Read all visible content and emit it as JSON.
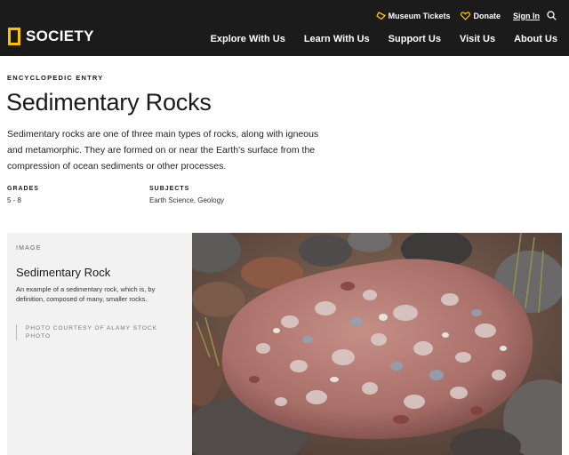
{
  "header": {
    "logo_text": "SOCIETY",
    "brand_color": "#fcc200",
    "utility": {
      "tickets_label": "Museum Tickets",
      "donate_label": "Donate",
      "signin_label": "Sign In"
    },
    "nav": [
      {
        "label": "Explore With Us"
      },
      {
        "label": "Learn With Us"
      },
      {
        "label": "Support Us"
      },
      {
        "label": "Visit Us"
      },
      {
        "label": "About Us"
      }
    ]
  },
  "article": {
    "eyebrow": "ENCYCLOPEDIC ENTRY",
    "title": "Sedimentary Rocks",
    "summary": "Sedimentary rocks are one of three main types of rocks, along with igneous and metamorphic. They are formed on or near the Earth's surface from the compression of ocean sediments or other processes.",
    "grades_label": "GRADES",
    "grades_value": "5 - 8",
    "subjects_label": "SUBJECTS",
    "subjects_value": "Earth Science, Geology"
  },
  "image_block": {
    "eyebrow": "IMAGE",
    "title": "Sedimentary Rock",
    "description": "An example of a sedimentary rock, which is, by definition, composed of many, smaller rocks.",
    "credit": "PHOTO COURTESY OF ALAMY STOCK PHOTO"
  }
}
